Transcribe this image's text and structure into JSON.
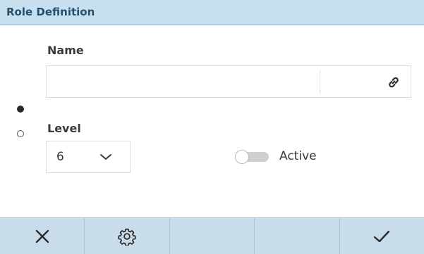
{
  "title_bar": {
    "title": "Role Definition"
  },
  "form": {
    "name_label": "Name",
    "name_value": "",
    "level_label": "Level",
    "level_value": "6",
    "active_label": "Active",
    "active_on": false
  },
  "pager": {
    "pages": 2,
    "current": 1
  },
  "icons": {
    "link": "link-icon",
    "chevron": "chevron-down-icon",
    "close": "close-icon",
    "settings": "gear-icon",
    "confirm": "checkmark-icon"
  },
  "colors": {
    "title_bar_bg": "#c7e0ef",
    "bottom_bar_bg": "#c9dcea",
    "text": "#3a3a3a"
  }
}
